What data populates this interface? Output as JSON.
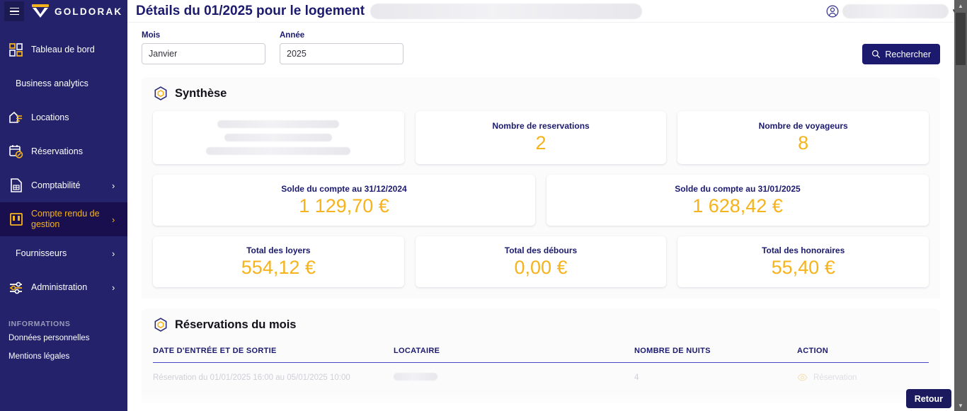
{
  "brand": {
    "name": "GOLDORAK",
    "logo_icon": "goldorak-logo-icon",
    "menu_icon": "hamburger-menu-icon"
  },
  "sidebar": {
    "items": [
      {
        "label": "Tableau de bord",
        "icon": "dashboard-grid-icon",
        "has_icon": true,
        "chevron": "",
        "active": false
      },
      {
        "label": "Business analytics",
        "icon": "",
        "has_icon": false,
        "chevron": "",
        "active": false
      },
      {
        "label": "Locations",
        "icon": "house-list-icon",
        "has_icon": true,
        "chevron": "",
        "active": false
      },
      {
        "label": "Réservations",
        "icon": "calendar-check-icon",
        "has_icon": true,
        "chevron": "",
        "active": false
      },
      {
        "label": "Comptabilité",
        "icon": "document-grid-icon",
        "has_icon": true,
        "chevron": "›",
        "active": false
      },
      {
        "label": "Compte rendu de gestion",
        "icon": "report-book-icon",
        "has_icon": true,
        "chevron": "›",
        "active": true
      },
      {
        "label": "Fournisseurs",
        "icon": "",
        "has_icon": false,
        "chevron": "›",
        "active": false
      },
      {
        "label": "Administration",
        "icon": "sliders-icon",
        "has_icon": true,
        "chevron": "›",
        "active": false
      }
    ],
    "information_title": "INFORMATIONS",
    "information_links": [
      {
        "label": "Données personnelles"
      },
      {
        "label": "Mentions légales"
      }
    ]
  },
  "topbar": {
    "title": "Détails du 01/2025 pour le logement",
    "title_redacted_suffix": "",
    "user_icon": "user-circle-icon",
    "user_name_redacted": "",
    "user_caret": "▼"
  },
  "filters": {
    "month": {
      "label": "Mois",
      "value": "Janvier",
      "placeholder": "Mois"
    },
    "year": {
      "label": "Année",
      "value": "2025",
      "placeholder": "Année"
    },
    "search_button": {
      "label": "Rechercher",
      "icon": "search-icon"
    }
  },
  "synthese": {
    "section_icon": "hexagon-dot-icon",
    "title": "Synthèse",
    "rows": [
      [
        {
          "type": "redacted",
          "lines": 3
        },
        {
          "type": "stat",
          "label": "Nombre de reservations",
          "value": "2"
        },
        {
          "type": "stat",
          "label": "Nombre de voyageurs",
          "value": "8"
        }
      ],
      [
        {
          "type": "stat",
          "label": "Solde du compte au 31/12/2024",
          "value": "1 129,70 €"
        },
        {
          "type": "stat",
          "label": "Solde du compte au 31/01/2025",
          "value": "1 628,42 €"
        }
      ],
      [
        {
          "type": "stat",
          "label": "Total des loyers",
          "value": "554,12 €"
        },
        {
          "type": "stat",
          "label": "Total des débours",
          "value": "0,00 €"
        },
        {
          "type": "stat",
          "label": "Total des honoraires",
          "value": "55,40 €"
        }
      ]
    ]
  },
  "reservations": {
    "section_icon": "hexagon-dot-icon",
    "title": "Réservations du mois",
    "columns": [
      "DATE D'ENTRÉE ET DE SORTIE",
      "LOCATAIRE",
      "NOMBRE DE NUITS",
      "ACTION"
    ],
    "rows": [
      {
        "date": "Réservation du 01/01/2025 16:00 au 05/01/2025 10:00",
        "locataire_redacted": "",
        "nights": "4",
        "action_label": "Réservation",
        "action_icon": "eye-icon"
      }
    ]
  },
  "footer": {
    "back_button": "Retour"
  },
  "scrollbar": {
    "up_arrow": "▲",
    "down_arrow": "▼"
  },
  "colors": {
    "sidebar_bg": "#23226b",
    "sidebar_active_bg": "#1a0f4e",
    "accent_orange": "#f5b31c",
    "primary_navy": "#1b1a6e",
    "table_rule": "#4b45c9"
  }
}
